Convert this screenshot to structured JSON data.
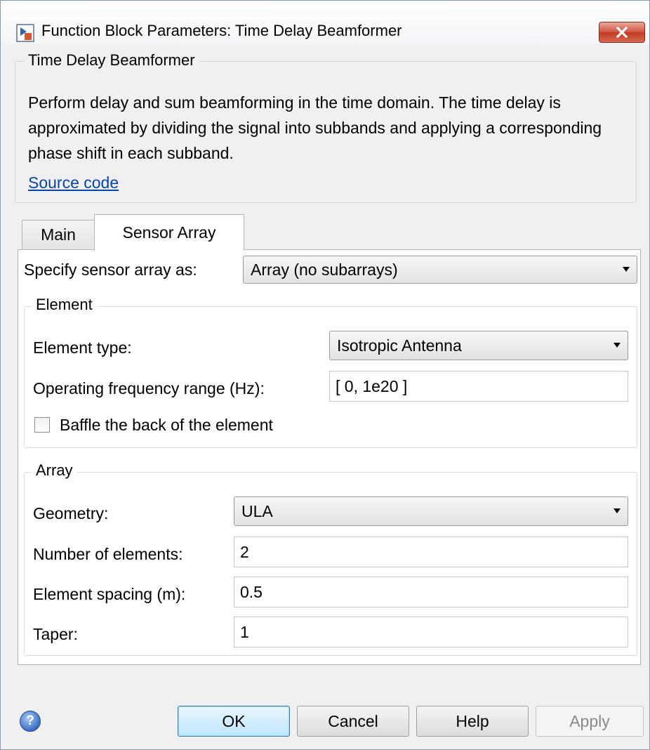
{
  "window": {
    "title": "Function Block Parameters: Time Delay Beamformer",
    "close_symbol": "✕"
  },
  "description": {
    "group_title": "Time Delay Beamformer",
    "text": "Perform delay and sum beamforming in the time domain. The time delay is approximated by dividing the signal into subbands and applying a corresponding phase shift in each subband.",
    "link": "Source code"
  },
  "tabs": [
    {
      "label": "Main",
      "active": false
    },
    {
      "label": "Sensor Array",
      "active": true
    }
  ],
  "sensor_array": {
    "specify_label": "Specify sensor array as:",
    "specify_value": "Array (no subarrays)"
  },
  "element": {
    "group_title": "Element",
    "type_label": "Element type:",
    "type_value": "Isotropic Antenna",
    "freq_label": "Operating frequency range (Hz):",
    "freq_value": "[ 0, 1e20 ]",
    "baffle_label": "Baffle the back of the element",
    "baffle_checked": false
  },
  "array": {
    "group_title": "Array",
    "geometry_label": "Geometry:",
    "geometry_value": "ULA",
    "num_elements_label": "Number of elements:",
    "num_elements_value": "2",
    "spacing_label": "Element spacing (m):",
    "spacing_value": "0.5",
    "taper_label": "Taper:",
    "taper_value": "1"
  },
  "buttons": {
    "help_icon": "?",
    "ok": "OK",
    "cancel": "Cancel",
    "help": "Help",
    "apply": "Apply"
  }
}
